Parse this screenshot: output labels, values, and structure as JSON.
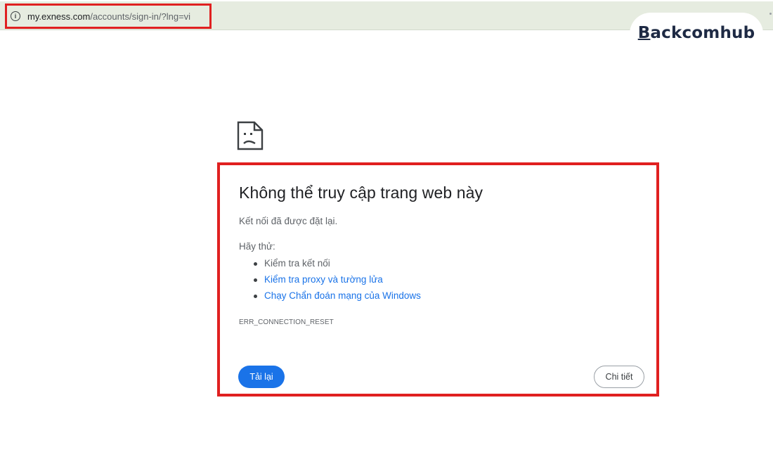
{
  "address_bar": {
    "url_host": "my.exness.com",
    "url_path": "/accounts/sign-in/?lng=vi",
    "info_icon": "info-icon"
  },
  "brand": {
    "name_first": "B",
    "name_rest": "ackcomhub"
  },
  "error": {
    "icon": "sad-page-icon",
    "title": "Không thể truy cập trang web này",
    "subtitle": "Kết nối đã được đặt lại.",
    "try_label": "Hãy thử:",
    "suggestions": [
      {
        "label": "Kiểm tra kết nối",
        "is_link": false
      },
      {
        "label": "Kiểm tra proxy và tường lửa",
        "is_link": true
      },
      {
        "label": "Chạy Chẩn đoán mạng của Windows",
        "is_link": true
      }
    ],
    "code": "ERR_CONNECTION_RESET",
    "reload_label": "Tải lại",
    "details_label": "Chi tiết"
  },
  "colors": {
    "highlight_border": "#e02020",
    "link": "#1a73e8",
    "primary_button": "#1a73e8",
    "address_bar_bg": "#e6ece0"
  }
}
